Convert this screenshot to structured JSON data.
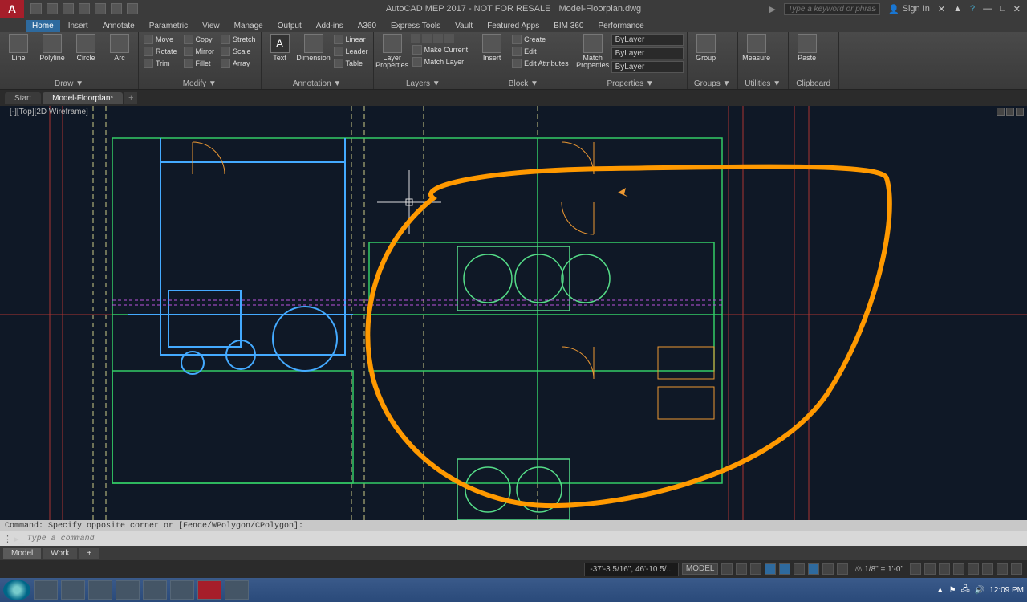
{
  "title": {
    "app": "AutoCAD MEP 2017 - NOT FOR RESALE",
    "file": "Model-Floorplan.dwg"
  },
  "search": {
    "placeholder": "Type a keyword or phrase"
  },
  "signin": "Sign In",
  "ribbonTabs": [
    "Home",
    "Insert",
    "Annotate",
    "Parametric",
    "View",
    "Manage",
    "Output",
    "Add-ins",
    "A360",
    "Express Tools",
    "Vault",
    "Featured Apps",
    "BIM 360",
    "Performance"
  ],
  "activeRibbonTab": "Home",
  "panels": {
    "draw": {
      "title": "Draw ▼",
      "items": [
        "Line",
        "Polyline",
        "Circle",
        "Arc"
      ]
    },
    "modify": {
      "title": "Modify ▼",
      "row1": [
        "Move",
        "Rotate",
        "Trim"
      ],
      "row2": [
        "Copy",
        "Mirror",
        "Fillet"
      ],
      "row3": [
        "Stretch",
        "Scale",
        "Array"
      ]
    },
    "annotation": {
      "title": "Annotation ▼",
      "big": [
        "Text",
        "Dimension"
      ],
      "rows": [
        "Linear",
        "Leader",
        "Table"
      ]
    },
    "layers": {
      "title": "Layers ▼",
      "big": "Layer\nProperties",
      "rows": [
        "Make Current",
        "Match Layer"
      ]
    },
    "block": {
      "title": "Block ▼",
      "big": "Insert",
      "rows": [
        "Create",
        "Edit",
        "Edit Attributes"
      ]
    },
    "properties": {
      "title": "Properties ▼",
      "big": "Match\nProperties",
      "layer": "ByLayer",
      "linetype": "ByLayer",
      "lineweight": "ByLayer"
    },
    "groups": {
      "title": "Groups ▼",
      "big": "Group"
    },
    "utilities": {
      "title": "Utilities ▼",
      "big": "Measure"
    },
    "clipboard": {
      "title": "Clipboard",
      "big": "Paste"
    }
  },
  "fileTabs": [
    "Start",
    "Model-Floorplan*"
  ],
  "activeFileTab": 1,
  "viewLabel": "[-][Top][2D Wireframe]",
  "layoutTabs": [
    "Model",
    "Work"
  ],
  "activeLayoutTab": 0,
  "command": {
    "history": "Command: Specify opposite corner or [Fence/WPolygon/CPolygon]:",
    "placeholder": "Type a command"
  },
  "status": {
    "coords": "-37'-3 5/16\", 46'-10 5/...",
    "space": "MODEL",
    "scale": "1/8\" = 1'-0\""
  },
  "taskbar": {
    "time": "12:09 PM"
  }
}
